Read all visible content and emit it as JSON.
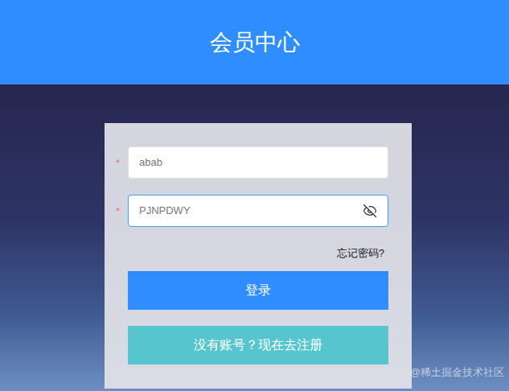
{
  "header": {
    "title": "会员中心"
  },
  "form": {
    "required_mark": "*",
    "fields": [
      {
        "kind": "text",
        "value": "abab",
        "required": true,
        "focused": false
      },
      {
        "kind": "password",
        "value": "PJNPDWY",
        "required": true,
        "focused": true
      }
    ],
    "forgot_link": "忘记密码?",
    "buttons": [
      {
        "label": "登录",
        "kind": "primary"
      },
      {
        "label": "没有账号？现在去注册",
        "kind": "secondary"
      }
    ]
  },
  "watermark": "@稀土掘金技术社区"
}
